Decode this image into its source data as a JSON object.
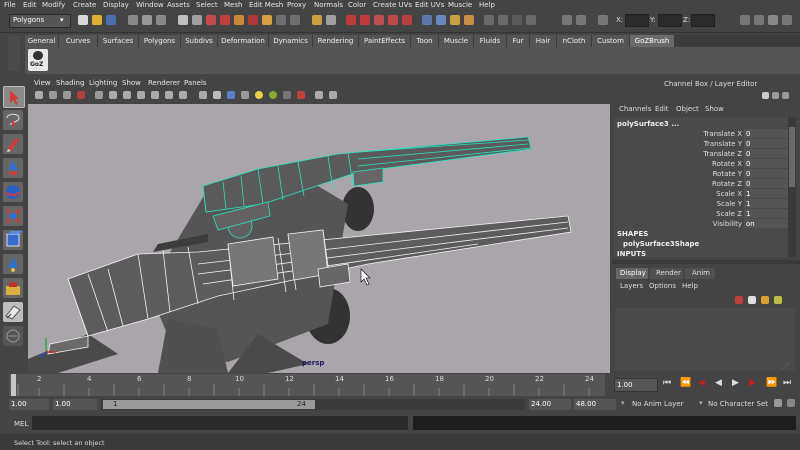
{
  "menus": [
    "File",
    "Edit",
    "Modify",
    "Create",
    "Display",
    "Window",
    "Assets",
    "Select",
    "Mesh",
    "Edit Mesh",
    "Proxy",
    "Normals",
    "Color",
    "Create UVs",
    "Edit UVs",
    "Muscle",
    "Help"
  ],
  "mode_selector": "Polygons",
  "xyz_fields": {
    "x": "X:",
    "y": "Y:",
    "z": "Z:"
  },
  "shelf_tabs": [
    "General",
    "Curves",
    "Surfaces",
    "Polygons",
    "Subdivs",
    "Deformation",
    "Dynamics",
    "Rendering",
    "PaintEffects",
    "Toon",
    "Muscle",
    "Fluids",
    "Fur",
    "Hair",
    "nCloth",
    "Custom",
    "GoZBrush"
  ],
  "shelf_active_tab": "GoZBrush",
  "goz_label": "GoZ",
  "panel_menus": [
    "View",
    "Shading",
    "Lighting",
    "Show",
    "Renderer",
    "Panels"
  ],
  "viewport_label": "persp",
  "channel_box": {
    "title": "Channel Box / Layer Editor",
    "menus": [
      "Channels",
      "Edit",
      "Object",
      "Show"
    ],
    "object_name": "polySurface3 ...",
    "attributes": [
      {
        "label": "Translate X",
        "value": "0"
      },
      {
        "label": "Translate Y",
        "value": "0"
      },
      {
        "label": "Translate Z",
        "value": "0"
      },
      {
        "label": "Rotate X",
        "value": "0"
      },
      {
        "label": "Rotate Y",
        "value": "0"
      },
      {
        "label": "Rotate Z",
        "value": "0"
      },
      {
        "label": "Scale X",
        "value": "1"
      },
      {
        "label": "Scale Y",
        "value": "1"
      },
      {
        "label": "Scale Z",
        "value": "1"
      },
      {
        "label": "Visibility",
        "value": "on"
      }
    ],
    "shapes_header": "SHAPES",
    "shape_name": "polySurface3Shape",
    "inputs_header": "INPUTS"
  },
  "layer_editor": {
    "tabs": [
      "Display",
      "Render",
      "Anim"
    ],
    "active_tab": "Display",
    "menus": [
      "Layers",
      "Options",
      "Help"
    ]
  },
  "time_slider": {
    "ticks": [
      "2",
      "4",
      "6",
      "8",
      "10",
      "12",
      "14",
      "16",
      "18",
      "20",
      "22",
      "24"
    ],
    "current_frame": "1.00"
  },
  "range_slider": {
    "start": "1.00",
    "playback_start": "1.00",
    "range_start_label": "1",
    "range_end_label": "24",
    "playback_end": "24.00",
    "end": "48.00",
    "anim_layer": "No Anim Layer",
    "character_set": "No Character Set"
  },
  "command_line_label": "MEL",
  "help_line": "Select Tool: select an object",
  "colors": {
    "ui_bg": "#444444",
    "viewport_bg": "#aaa4ab",
    "wireframe_selected": "#2de0c0",
    "playback_red": "#c02020"
  }
}
